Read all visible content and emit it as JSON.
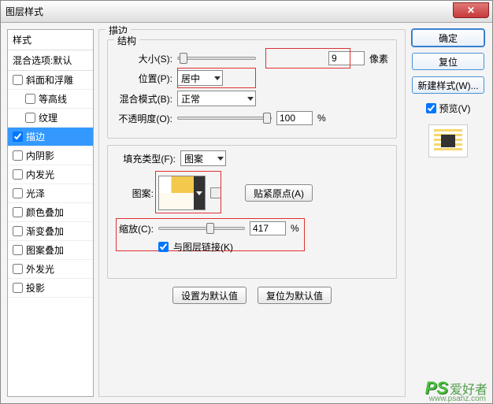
{
  "window": {
    "title": "图层样式"
  },
  "left": {
    "header": "样式",
    "subheader": "混合选项:默认",
    "items": [
      {
        "label": "斜面和浮雕",
        "checked": false,
        "indent": false
      },
      {
        "label": "等高线",
        "checked": false,
        "indent": true
      },
      {
        "label": "纹理",
        "checked": false,
        "indent": true
      },
      {
        "label": "描边",
        "checked": true,
        "indent": false,
        "active": true
      },
      {
        "label": "内阴影",
        "checked": false,
        "indent": false
      },
      {
        "label": "内发光",
        "checked": false,
        "indent": false
      },
      {
        "label": "光泽",
        "checked": false,
        "indent": false
      },
      {
        "label": "颜色叠加",
        "checked": false,
        "indent": false
      },
      {
        "label": "渐变叠加",
        "checked": false,
        "indent": false
      },
      {
        "label": "图案叠加",
        "checked": false,
        "indent": false
      },
      {
        "label": "外发光",
        "checked": false,
        "indent": false
      },
      {
        "label": "投影",
        "checked": false,
        "indent": false
      }
    ]
  },
  "center": {
    "outer_legend": "描边",
    "struct_legend": "结构",
    "size_label": "大小(S):",
    "size_value": "9",
    "size_unit": "像素",
    "pos_label": "位置(P):",
    "pos_value": "居中",
    "blend_label": "混合模式(B):",
    "blend_value": "正常",
    "opacity_label": "不透明度(O):",
    "opacity_value": "100",
    "opacity_unit": "%",
    "filltype_label": "填充类型(F):",
    "filltype_value": "图案",
    "pattern_label": "图案:",
    "snap_btn": "贴紧原点(A)",
    "scale_label": "缩放(C):",
    "scale_value": "417",
    "scale_unit": "%",
    "link_label": "与图层链接(K)",
    "set_default_btn": "设置为默认值",
    "reset_default_btn": "复位为默认值"
  },
  "right": {
    "ok": "确定",
    "cancel": "复位",
    "new_style": "新建样式(W)...",
    "preview": "预览(V)"
  },
  "watermark": {
    "ps": "PS",
    "cn": "爱好者",
    "url": "www.psahz.com"
  }
}
